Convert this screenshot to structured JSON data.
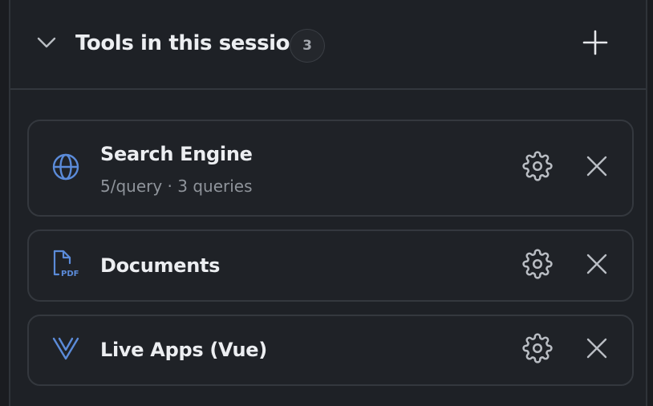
{
  "header": {
    "title": "Tools in this session",
    "count": "3"
  },
  "tools": [
    {
      "name": "Search Engine",
      "meta": "5/query · 3 queries",
      "icon": "globe-icon"
    },
    {
      "name": "Documents",
      "icon": "pdf-file-icon"
    },
    {
      "name": "Live Apps (Vue)",
      "icon": "vue-icon"
    }
  ],
  "colors": {
    "background": "#1e2126",
    "card_border": "#34383e",
    "accent_icon": "#5b8bd9",
    "text_primary": "#eceef1",
    "text_secondary": "#8f949b",
    "control_icon": "#b9bdc3"
  }
}
